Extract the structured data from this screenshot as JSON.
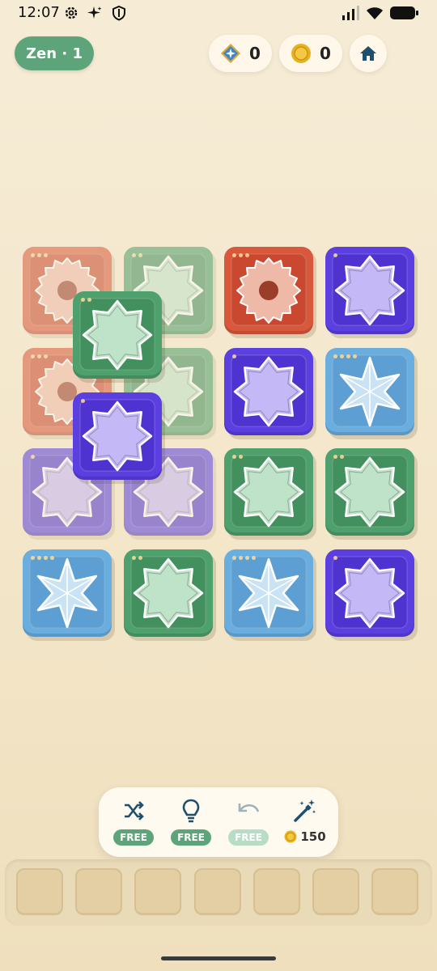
{
  "status_bar": {
    "time": "12:07"
  },
  "header": {
    "mode_label": "Zen · 1",
    "gems_count": "0",
    "coins_count": "0"
  },
  "board": {
    "tiles": [
      {
        "row": 0,
        "col": 0,
        "color": "orange",
        "symbol": "sunburst",
        "dots": 3,
        "faded": true
      },
      {
        "row": 0,
        "col": 1,
        "color": "green",
        "symbol": "octagram",
        "dots": 2,
        "faded": true
      },
      {
        "row": 0,
        "col": 2,
        "color": "orange",
        "symbol": "sunburst",
        "dots": 3,
        "faded": false
      },
      {
        "row": 0,
        "col": 3,
        "color": "purple",
        "symbol": "octagram",
        "dots": 1,
        "faded": false
      },
      {
        "row": 1,
        "col": 0,
        "color": "orange",
        "symbol": "sunburst",
        "dots": 3,
        "faded": true
      },
      {
        "row": 1,
        "col": 1,
        "color": "green",
        "symbol": "octagram",
        "dots": 2,
        "faded": true
      },
      {
        "row": 1,
        "col": 2,
        "color": "purple",
        "symbol": "octagram",
        "dots": 1,
        "faded": false
      },
      {
        "row": 1,
        "col": 3,
        "color": "blue",
        "symbol": "hexagram",
        "dots": 4,
        "faded": false
      },
      {
        "row": 2,
        "col": 0,
        "color": "purple",
        "symbol": "octagram",
        "dots": 1,
        "faded": true
      },
      {
        "row": 2,
        "col": 1,
        "color": "purple",
        "symbol": "octagram",
        "dots": 1,
        "faded": true
      },
      {
        "row": 2,
        "col": 2,
        "color": "green",
        "symbol": "octagram",
        "dots": 2,
        "faded": false
      },
      {
        "row": 2,
        "col": 3,
        "color": "green",
        "symbol": "octagram",
        "dots": 2,
        "faded": false
      },
      {
        "row": 3,
        "col": 0,
        "color": "blue",
        "symbol": "hexagram",
        "dots": 4,
        "faded": false
      },
      {
        "row": 3,
        "col": 1,
        "color": "green",
        "symbol": "octagram",
        "dots": 2,
        "faded": false
      },
      {
        "row": 3,
        "col": 2,
        "color": "blue",
        "symbol": "hexagram",
        "dots": 4,
        "faded": false
      },
      {
        "row": 3,
        "col": 3,
        "color": "purple",
        "symbol": "octagram",
        "dots": 1,
        "faded": false
      }
    ],
    "stacked_tiles": [
      {
        "color": "green",
        "symbol": "octagram",
        "dots": 2
      },
      {
        "color": "purple",
        "symbol": "octagram",
        "dots": 1
      }
    ]
  },
  "tools": {
    "shuffle_label": "FREE",
    "hint_label": "FREE",
    "undo_label": "FREE",
    "magic_cost": "150"
  },
  "tray": {
    "slot_count": 7
  },
  "colors": {
    "accent_green": "#5da47a",
    "orange_tile": "#d9583b",
    "green_tile": "#4ea06c",
    "purple_tile": "#5b3fe0",
    "blue_tile": "#6aaee0",
    "icon_dark": "#1f4f6a"
  }
}
